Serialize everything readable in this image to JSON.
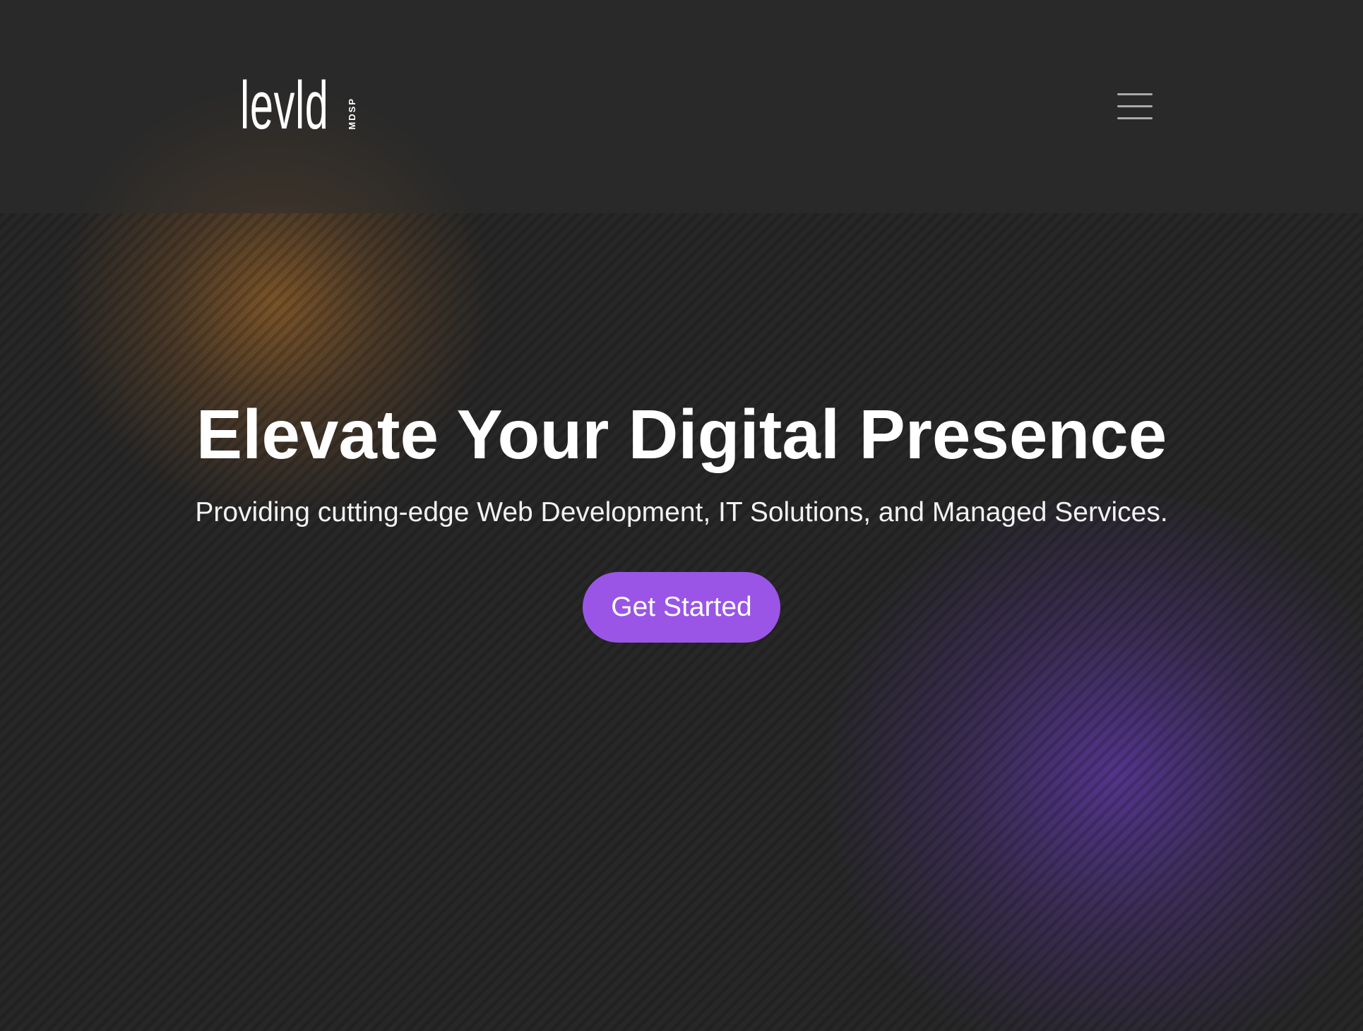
{
  "header": {
    "logo": {
      "word": "levld",
      "sub": "MDSP"
    },
    "menu_icon": "hamburger-menu-icon"
  },
  "hero": {
    "title": "Elevate Your Digital Presence",
    "subtitle": "Providing cutting-edge Web Development, IT Solutions, and Managed Services.",
    "cta_label": "Get Started"
  },
  "colors": {
    "background": "#272727",
    "accent": "#9a55e6",
    "glow_orange": "#be7828",
    "glow_purple": "#6e3cc8",
    "text": "#ffffff",
    "menu_icon": "#a9a9a9"
  }
}
